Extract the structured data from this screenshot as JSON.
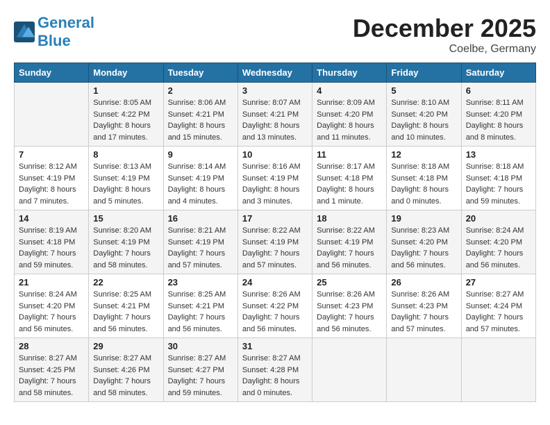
{
  "header": {
    "logo_general": "General",
    "logo_blue": "Blue",
    "month_title": "December 2025",
    "location": "Coelbe, Germany"
  },
  "weekdays": [
    "Sunday",
    "Monday",
    "Tuesday",
    "Wednesday",
    "Thursday",
    "Friday",
    "Saturday"
  ],
  "weeks": [
    [
      {
        "day": "",
        "info": ""
      },
      {
        "day": "1",
        "info": "Sunrise: 8:05 AM\nSunset: 4:22 PM\nDaylight: 8 hours\nand 17 minutes."
      },
      {
        "day": "2",
        "info": "Sunrise: 8:06 AM\nSunset: 4:21 PM\nDaylight: 8 hours\nand 15 minutes."
      },
      {
        "day": "3",
        "info": "Sunrise: 8:07 AM\nSunset: 4:21 PM\nDaylight: 8 hours\nand 13 minutes."
      },
      {
        "day": "4",
        "info": "Sunrise: 8:09 AM\nSunset: 4:20 PM\nDaylight: 8 hours\nand 11 minutes."
      },
      {
        "day": "5",
        "info": "Sunrise: 8:10 AM\nSunset: 4:20 PM\nDaylight: 8 hours\nand 10 minutes."
      },
      {
        "day": "6",
        "info": "Sunrise: 8:11 AM\nSunset: 4:20 PM\nDaylight: 8 hours\nand 8 minutes."
      }
    ],
    [
      {
        "day": "7",
        "info": "Sunrise: 8:12 AM\nSunset: 4:19 PM\nDaylight: 8 hours\nand 7 minutes."
      },
      {
        "day": "8",
        "info": "Sunrise: 8:13 AM\nSunset: 4:19 PM\nDaylight: 8 hours\nand 5 minutes."
      },
      {
        "day": "9",
        "info": "Sunrise: 8:14 AM\nSunset: 4:19 PM\nDaylight: 8 hours\nand 4 minutes."
      },
      {
        "day": "10",
        "info": "Sunrise: 8:16 AM\nSunset: 4:19 PM\nDaylight: 8 hours\nand 3 minutes."
      },
      {
        "day": "11",
        "info": "Sunrise: 8:17 AM\nSunset: 4:18 PM\nDaylight: 8 hours\nand 1 minute."
      },
      {
        "day": "12",
        "info": "Sunrise: 8:18 AM\nSunset: 4:18 PM\nDaylight: 8 hours\nand 0 minutes."
      },
      {
        "day": "13",
        "info": "Sunrise: 8:18 AM\nSunset: 4:18 PM\nDaylight: 7 hours\nand 59 minutes."
      }
    ],
    [
      {
        "day": "14",
        "info": "Sunrise: 8:19 AM\nSunset: 4:18 PM\nDaylight: 7 hours\nand 59 minutes."
      },
      {
        "day": "15",
        "info": "Sunrise: 8:20 AM\nSunset: 4:19 PM\nDaylight: 7 hours\nand 58 minutes."
      },
      {
        "day": "16",
        "info": "Sunrise: 8:21 AM\nSunset: 4:19 PM\nDaylight: 7 hours\nand 57 minutes."
      },
      {
        "day": "17",
        "info": "Sunrise: 8:22 AM\nSunset: 4:19 PM\nDaylight: 7 hours\nand 57 minutes."
      },
      {
        "day": "18",
        "info": "Sunrise: 8:22 AM\nSunset: 4:19 PM\nDaylight: 7 hours\nand 56 minutes."
      },
      {
        "day": "19",
        "info": "Sunrise: 8:23 AM\nSunset: 4:20 PM\nDaylight: 7 hours\nand 56 minutes."
      },
      {
        "day": "20",
        "info": "Sunrise: 8:24 AM\nSunset: 4:20 PM\nDaylight: 7 hours\nand 56 minutes."
      }
    ],
    [
      {
        "day": "21",
        "info": "Sunrise: 8:24 AM\nSunset: 4:20 PM\nDaylight: 7 hours\nand 56 minutes."
      },
      {
        "day": "22",
        "info": "Sunrise: 8:25 AM\nSunset: 4:21 PM\nDaylight: 7 hours\nand 56 minutes."
      },
      {
        "day": "23",
        "info": "Sunrise: 8:25 AM\nSunset: 4:21 PM\nDaylight: 7 hours\nand 56 minutes."
      },
      {
        "day": "24",
        "info": "Sunrise: 8:26 AM\nSunset: 4:22 PM\nDaylight: 7 hours\nand 56 minutes."
      },
      {
        "day": "25",
        "info": "Sunrise: 8:26 AM\nSunset: 4:23 PM\nDaylight: 7 hours\nand 56 minutes."
      },
      {
        "day": "26",
        "info": "Sunrise: 8:26 AM\nSunset: 4:23 PM\nDaylight: 7 hours\nand 57 minutes."
      },
      {
        "day": "27",
        "info": "Sunrise: 8:27 AM\nSunset: 4:24 PM\nDaylight: 7 hours\nand 57 minutes."
      }
    ],
    [
      {
        "day": "28",
        "info": "Sunrise: 8:27 AM\nSunset: 4:25 PM\nDaylight: 7 hours\nand 58 minutes."
      },
      {
        "day": "29",
        "info": "Sunrise: 8:27 AM\nSunset: 4:26 PM\nDaylight: 7 hours\nand 58 minutes."
      },
      {
        "day": "30",
        "info": "Sunrise: 8:27 AM\nSunset: 4:27 PM\nDaylight: 7 hours\nand 59 minutes."
      },
      {
        "day": "31",
        "info": "Sunrise: 8:27 AM\nSunset: 4:28 PM\nDaylight: 8 hours\nand 0 minutes."
      },
      {
        "day": "",
        "info": ""
      },
      {
        "day": "",
        "info": ""
      },
      {
        "day": "",
        "info": ""
      }
    ]
  ]
}
